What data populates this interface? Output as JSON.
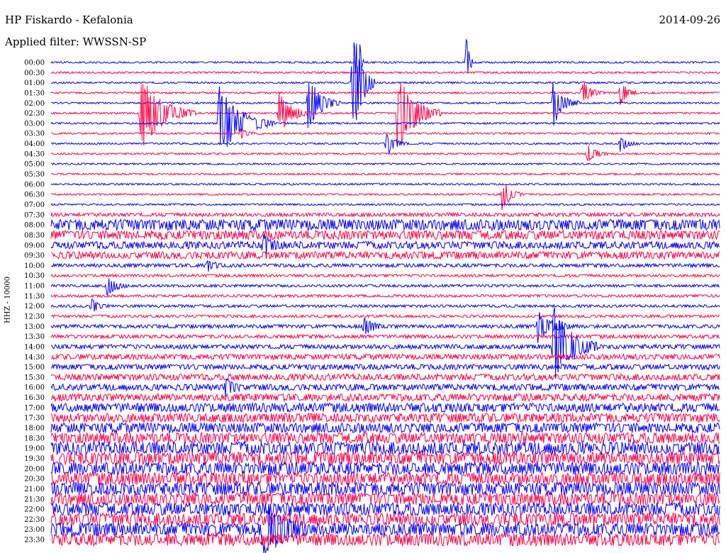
{
  "header": {
    "station": "HP Fiskardo - Kefalonia",
    "filter": "Applied filter: WWSSN-SP",
    "date": "2014-09-26",
    "channel": "HHZ - 10000"
  },
  "colors": {
    "even_line": "#0000ff",
    "odd_line": "#ff0044"
  },
  "chart_data": {
    "type": "line",
    "subtype": "helicorder",
    "title": "HP Fiskardo - Kefalonia",
    "subtitle": "Applied filter: WWSSN-SP",
    "date": "2014-09-26",
    "ylabel": "HHZ - 10000",
    "line_duration_minutes": 30,
    "row_labels": [
      "00:00",
      "00:30",
      "01:00",
      "01:30",
      "02:00",
      "02:30",
      "03:00",
      "03:30",
      "04:00",
      "04:30",
      "05:00",
      "05:30",
      "06:00",
      "06:30",
      "07:00",
      "07:30",
      "08:00",
      "08:30",
      "09:00",
      "09:30",
      "10:00",
      "10:30",
      "11:00",
      "11:30",
      "12:00",
      "12:30",
      "13:00",
      "13:30",
      "14:00",
      "14:30",
      "15:00",
      "15:30",
      "16:00",
      "16:30",
      "17:00",
      "17:30",
      "18:00",
      "18:30",
      "19:00",
      "19:30",
      "20:00",
      "20:30",
      "21:00",
      "21:30",
      "22:00",
      "22:30",
      "23:00",
      "23:30"
    ],
    "noise_levels": [
      1,
      1,
      1,
      1,
      1,
      1,
      1,
      1,
      1,
      1,
      1,
      1,
      1,
      1,
      1,
      2,
      6,
      5,
      4,
      4,
      2,
      1.5,
      1.5,
      1.5,
      1.5,
      1.5,
      2,
      2,
      2.5,
      3,
      3,
      3.5,
      3.5,
      4,
      5,
      5,
      5.5,
      6,
      7,
      7,
      7,
      7,
      7,
      7,
      7,
      7,
      7,
      7
    ],
    "events": [
      {
        "row": 5,
        "minute": 4.0,
        "amplitude": 55,
        "duration_min": 2.5
      },
      {
        "row": 6,
        "minute": 7.5,
        "amplitude": 55,
        "duration_min": 2.5
      },
      {
        "row": 5,
        "minute": 10.2,
        "amplitude": 30,
        "duration_min": 1.5
      },
      {
        "row": 5,
        "minute": 15.5,
        "amplitude": 60,
        "duration_min": 2.0
      },
      {
        "row": 2,
        "minute": 13.5,
        "amplitude": 100,
        "duration_min": 1.0
      },
      {
        "row": 4,
        "minute": 11.5,
        "amplitude": 40,
        "duration_min": 1.5
      },
      {
        "row": 8,
        "minute": 15.0,
        "amplitude": 20,
        "duration_min": 1.0
      },
      {
        "row": 4,
        "minute": 22.5,
        "amplitude": 35,
        "duration_min": 1.2
      },
      {
        "row": 3,
        "minute": 25.5,
        "amplitude": 20,
        "duration_min": 0.8
      },
      {
        "row": 9,
        "minute": 24.0,
        "amplitude": 15,
        "duration_min": 1.0
      },
      {
        "row": 7,
        "minute": 8.5,
        "amplitude": 12,
        "duration_min": 0.6
      },
      {
        "row": 3,
        "minute": 23.8,
        "amplitude": 20,
        "duration_min": 1.0
      },
      {
        "row": 18,
        "minute": 9.5,
        "amplitude": 15,
        "duration_min": 1.0
      },
      {
        "row": 20,
        "minute": 7.0,
        "amplitude": 10,
        "duration_min": 0.8
      },
      {
        "row": 22,
        "minute": 2.5,
        "amplitude": 15,
        "duration_min": 1.0
      },
      {
        "row": 24,
        "minute": 1.8,
        "amplitude": 12,
        "duration_min": 0.8
      },
      {
        "row": 28,
        "minute": 22.5,
        "amplitude": 60,
        "duration_min": 2.0
      },
      {
        "row": 26,
        "minute": 21.8,
        "amplitude": 25,
        "duration_min": 1.5
      },
      {
        "row": 26,
        "minute": 14.0,
        "amplitude": 15,
        "duration_min": 1.0
      },
      {
        "row": 32,
        "minute": 7.8,
        "amplitude": 15,
        "duration_min": 0.8
      },
      {
        "row": 46,
        "minute": 9.5,
        "amplitude": 50,
        "duration_min": 2.0
      },
      {
        "row": 0,
        "minute": 13.7,
        "amplitude": 95,
        "duration_min": 0.3
      },
      {
        "row": 0,
        "minute": 18.6,
        "amplitude": 60,
        "duration_min": 0.3
      },
      {
        "row": 8,
        "minute": 25.5,
        "amplitude": 12,
        "duration_min": 0.8
      },
      {
        "row": 13,
        "minute": 20.2,
        "amplitude": 25,
        "duration_min": 1.0
      }
    ]
  }
}
